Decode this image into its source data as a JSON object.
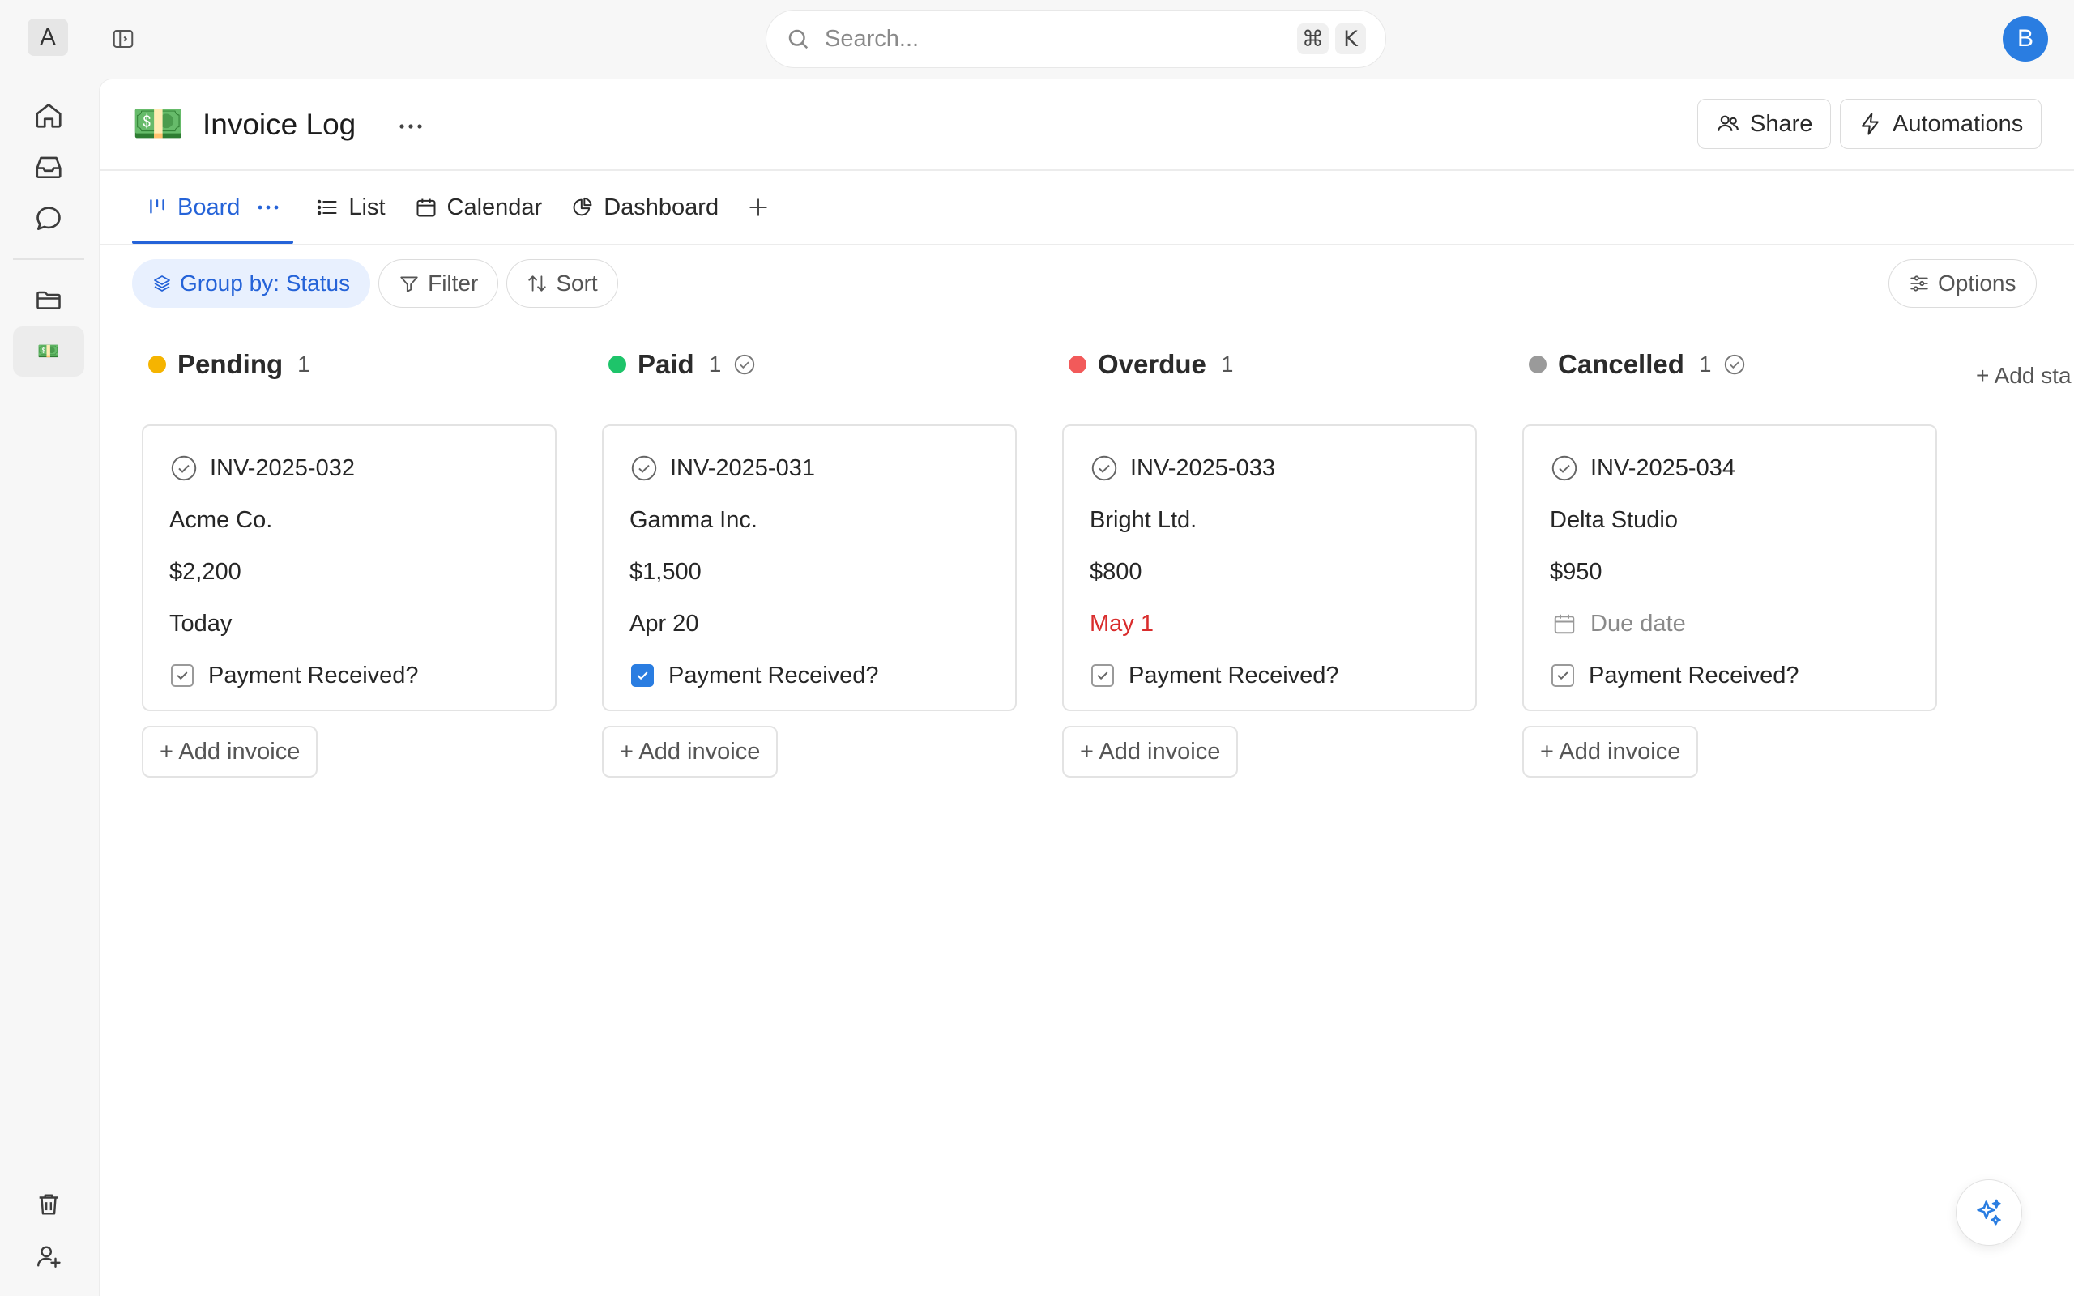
{
  "workspace": {
    "initial": "A"
  },
  "search": {
    "placeholder": "Search...",
    "shortcut_cmd": "⌘",
    "shortcut_key": "K"
  },
  "user": {
    "initial": "B",
    "color": "#2a7de1"
  },
  "rail": {
    "items": [
      {
        "icon": "home-icon"
      },
      {
        "icon": "inbox-icon"
      },
      {
        "icon": "chat-icon"
      },
      {
        "icon": "folder-icon"
      },
      {
        "icon": "money-emoji",
        "emoji": "💵",
        "active": true
      }
    ],
    "bottom": [
      {
        "icon": "trash-icon"
      },
      {
        "icon": "add-user-icon"
      }
    ]
  },
  "page": {
    "emoji": "💵",
    "title": "Invoice Log",
    "share_label": "Share",
    "automations_label": "Automations"
  },
  "tabs": [
    {
      "label": "Board",
      "icon": "board-icon",
      "active": true
    },
    {
      "label": "List",
      "icon": "list-icon"
    },
    {
      "label": "Calendar",
      "icon": "calendar-icon"
    },
    {
      "label": "Dashboard",
      "icon": "chart-pie-icon"
    }
  ],
  "toolbar": {
    "group_by": "Group by: Status",
    "filter": "Filter",
    "sort": "Sort",
    "options": "Options"
  },
  "columns": [
    {
      "name": "Pending",
      "count": "1",
      "color": "#f5b400",
      "done_icon": false,
      "card": {
        "id": "INV-2025-032",
        "client": "Acme Co.",
        "amount": "$2,200",
        "due": "Today",
        "due_state": "normal",
        "payment_label": "Payment Received?",
        "paid": false
      }
    },
    {
      "name": "Paid",
      "count": "1",
      "color": "#1ec46a",
      "done_icon": true,
      "card": {
        "id": "INV-2025-031",
        "client": "Gamma Inc.",
        "amount": "$1,500",
        "due": "Apr 20",
        "due_state": "normal",
        "payment_label": "Payment Received?",
        "paid": true
      }
    },
    {
      "name": "Overdue",
      "count": "1",
      "color": "#f25a5a",
      "done_icon": false,
      "card": {
        "id": "INV-2025-033",
        "client": "Bright Ltd.",
        "amount": "$800",
        "due": "May 1",
        "due_state": "overdue",
        "payment_label": "Payment Received?",
        "paid": false
      }
    },
    {
      "name": "Cancelled",
      "count": "1",
      "color": "#9a9a9a",
      "done_icon": true,
      "card": {
        "id": "INV-2025-034",
        "client": "Delta Studio",
        "amount": "$950",
        "due": "Due date",
        "due_state": "placeholder",
        "payment_label": "Payment Received?",
        "paid": false
      }
    }
  ],
  "board": {
    "add_card_label": "+ Add invoice",
    "add_status_label": "+ Add sta"
  }
}
